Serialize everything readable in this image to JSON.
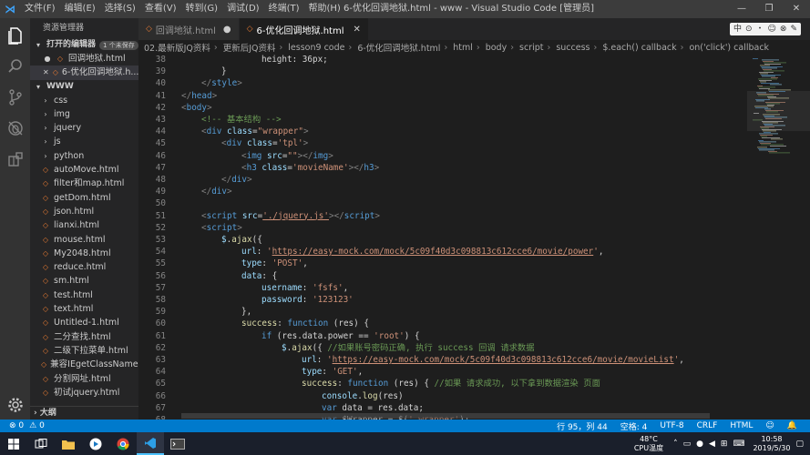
{
  "titlebar": {
    "menu": [
      "文件(F)",
      "编辑(E)",
      "选择(S)",
      "查看(V)",
      "转到(G)",
      "调试(D)",
      "终端(T)",
      "帮助(H)"
    ],
    "window_title": "6-优化回调地狱.html - www - Visual Studio Code [管理员]",
    "controls": [
      "—",
      "❐",
      "✕"
    ]
  },
  "sidebar": {
    "title": "资源管理器",
    "open_editors_label": "打开的编辑器",
    "unsaved_badge": "1 个未保存",
    "open_editors": [
      {
        "marker": "●",
        "name": "回调地狱.html"
      },
      {
        "marker": "✕",
        "name": "6-优化回调地狱.h..."
      }
    ],
    "folder": "WWW",
    "folders": [
      "css",
      "img",
      "jquery",
      "js",
      "python"
    ],
    "files": [
      "autoMove.html",
      "filter和map.html",
      "getDom.html",
      "json.html",
      "lianxi.html",
      "mouse.html",
      "My2048.html",
      "reduce.html",
      "sm.html",
      "test.html",
      "text.html",
      "Untitled-1.html",
      "二分查找.html",
      "二级下拉菜单.html",
      "兼容IEgetClassName...",
      "分割网址.html",
      "初试jquery.html"
    ],
    "outline_label": "大纲"
  },
  "tabs": [
    {
      "label": "回调地狱.html",
      "state": "●",
      "active": false
    },
    {
      "label": "6-优化回调地狱.html",
      "state": "✕",
      "active": true
    }
  ],
  "ime": [
    "中",
    "⊙",
    "・",
    "☺",
    "⊗",
    "✎"
  ],
  "breadcrumb": [
    "02.最新版JQ资料",
    "更新后JQ资料",
    "lesson9 code",
    "6-优化回调地狱.html",
    "html",
    "body",
    "script",
    "success",
    "$.each() callback",
    "on('click') callback"
  ],
  "editor": {
    "lines": [
      {
        "n": "38",
        "indent": 4,
        "tokens": [
          [
            "txt",
            "height: 36px;"
          ]
        ]
      },
      {
        "n": "39",
        "indent": 2,
        "tokens": [
          [
            "txt",
            "}"
          ]
        ]
      },
      {
        "n": "40",
        "indent": 1,
        "tokens": [
          [
            "punc",
            "</"
          ],
          [
            "tag",
            "style"
          ],
          [
            "punc",
            ">"
          ]
        ]
      },
      {
        "n": "41",
        "indent": 0,
        "tokens": [
          [
            "punc",
            "</"
          ],
          [
            "tag",
            "head"
          ],
          [
            "punc",
            ">"
          ]
        ]
      },
      {
        "n": "42",
        "indent": 0,
        "tokens": [
          [
            "punc",
            "<"
          ],
          [
            "tag",
            "body"
          ],
          [
            "punc",
            ">"
          ]
        ]
      },
      {
        "n": "43",
        "indent": 1,
        "tokens": [
          [
            "com",
            "<!-- 基本结构 -->"
          ]
        ]
      },
      {
        "n": "44",
        "indent": 1,
        "tokens": [
          [
            "punc",
            "<"
          ],
          [
            "tag",
            "div"
          ],
          [
            "txt",
            " "
          ],
          [
            "attr",
            "class"
          ],
          [
            "txt",
            "="
          ],
          [
            "str",
            "\"wrapper\""
          ],
          [
            "punc",
            ">"
          ]
        ]
      },
      {
        "n": "45",
        "indent": 2,
        "tokens": [
          [
            "punc",
            "<"
          ],
          [
            "tag",
            "div"
          ],
          [
            "txt",
            " "
          ],
          [
            "attr",
            "class"
          ],
          [
            "txt",
            "="
          ],
          [
            "str",
            "'tpl'"
          ],
          [
            "punc",
            ">"
          ]
        ]
      },
      {
        "n": "46",
        "indent": 3,
        "tokens": [
          [
            "punc",
            "<"
          ],
          [
            "tag",
            "img"
          ],
          [
            "txt",
            " "
          ],
          [
            "attr",
            "src"
          ],
          [
            "txt",
            "="
          ],
          [
            "str",
            "\"\""
          ],
          [
            "punc",
            "></"
          ],
          [
            "tag",
            "img"
          ],
          [
            "punc",
            ">"
          ]
        ]
      },
      {
        "n": "47",
        "indent": 3,
        "tokens": [
          [
            "punc",
            "<"
          ],
          [
            "tag",
            "h3"
          ],
          [
            "txt",
            " "
          ],
          [
            "attr",
            "class"
          ],
          [
            "txt",
            "="
          ],
          [
            "str",
            "'movieName'"
          ],
          [
            "punc",
            "></"
          ],
          [
            "tag",
            "h3"
          ],
          [
            "punc",
            ">"
          ]
        ]
      },
      {
        "n": "48",
        "indent": 2,
        "tokens": [
          [
            "punc",
            "</"
          ],
          [
            "tag",
            "div"
          ],
          [
            "punc",
            ">"
          ]
        ]
      },
      {
        "n": "49",
        "indent": 1,
        "tokens": [
          [
            "punc",
            "</"
          ],
          [
            "tag",
            "div"
          ],
          [
            "punc",
            ">"
          ]
        ]
      },
      {
        "n": "50",
        "indent": 0,
        "tokens": []
      },
      {
        "n": "51",
        "indent": 1,
        "tokens": [
          [
            "punc",
            "<"
          ],
          [
            "tag",
            "script"
          ],
          [
            "txt",
            " "
          ],
          [
            "attr",
            "src"
          ],
          [
            "txt",
            "="
          ],
          [
            "url",
            "'./jquery.js'"
          ],
          [
            "punc",
            "></"
          ],
          [
            "tag",
            "script"
          ],
          [
            "punc",
            ">"
          ]
        ]
      },
      {
        "n": "52",
        "indent": 1,
        "tokens": [
          [
            "punc",
            "<"
          ],
          [
            "tag",
            "script"
          ],
          [
            "punc",
            ">"
          ]
        ]
      },
      {
        "n": "53",
        "indent": 2,
        "tokens": [
          [
            "prop",
            "$"
          ],
          [
            "txt",
            "."
          ],
          [
            "fn",
            "ajax"
          ],
          [
            "txt",
            "({"
          ]
        ]
      },
      {
        "n": "54",
        "indent": 3,
        "tokens": [
          [
            "prop",
            "url"
          ],
          [
            "txt",
            ": "
          ],
          [
            "str",
            "'"
          ],
          [
            "url",
            "https://easy-mock.com/mock/5c09f40d3c098813c612cce6/movie/power"
          ],
          [
            "str",
            "'"
          ],
          [
            "txt",
            ","
          ]
        ]
      },
      {
        "n": "55",
        "indent": 3,
        "tokens": [
          [
            "prop",
            "type"
          ],
          [
            "txt",
            ": "
          ],
          [
            "str",
            "'POST'"
          ],
          [
            "txt",
            ","
          ]
        ]
      },
      {
        "n": "56",
        "indent": 3,
        "tokens": [
          [
            "prop",
            "data"
          ],
          [
            "txt",
            ": {"
          ]
        ]
      },
      {
        "n": "57",
        "indent": 4,
        "tokens": [
          [
            "prop",
            "username"
          ],
          [
            "txt",
            ": "
          ],
          [
            "str",
            "'fsfs'"
          ],
          [
            "txt",
            ","
          ]
        ]
      },
      {
        "n": "58",
        "indent": 4,
        "tokens": [
          [
            "prop",
            "password"
          ],
          [
            "txt",
            ": "
          ],
          [
            "str",
            "'123123'"
          ]
        ]
      },
      {
        "n": "59",
        "indent": 3,
        "tokens": [
          [
            "txt",
            "},"
          ]
        ]
      },
      {
        "n": "60",
        "indent": 3,
        "tokens": [
          [
            "fn",
            "success"
          ],
          [
            "txt",
            ": "
          ],
          [
            "kw",
            "function"
          ],
          [
            "txt",
            " (res) {"
          ]
        ]
      },
      {
        "n": "61",
        "indent": 4,
        "tokens": [
          [
            "kw",
            "if"
          ],
          [
            "txt",
            " (res.data.power == "
          ],
          [
            "str",
            "'root'"
          ],
          [
            "txt",
            ") {"
          ]
        ]
      },
      {
        "n": "62",
        "indent": 5,
        "tokens": [
          [
            "prop",
            "$"
          ],
          [
            "txt",
            "."
          ],
          [
            "fn",
            "ajax"
          ],
          [
            "txt",
            "({ "
          ],
          [
            "com",
            "//如果账号密码正确, 执行 success 回调 请求数据"
          ]
        ]
      },
      {
        "n": "63",
        "indent": 6,
        "tokens": [
          [
            "prop",
            "url"
          ],
          [
            "txt",
            ": "
          ],
          [
            "str",
            "'"
          ],
          [
            "url",
            "https://easy-mock.com/mock/5c09f40d3c098813c612cce6/movie/movieList"
          ],
          [
            "str",
            "'"
          ],
          [
            "txt",
            ","
          ]
        ]
      },
      {
        "n": "64",
        "indent": 6,
        "tokens": [
          [
            "prop",
            "type"
          ],
          [
            "txt",
            ": "
          ],
          [
            "str",
            "'GET'"
          ],
          [
            "txt",
            ","
          ]
        ]
      },
      {
        "n": "65",
        "indent": 6,
        "tokens": [
          [
            "fn",
            "success"
          ],
          [
            "txt",
            ": "
          ],
          [
            "kw",
            "function"
          ],
          [
            "txt",
            " (res) { "
          ],
          [
            "com",
            "//如果 请求成功, 以下拿到数据渲染 页面"
          ]
        ]
      },
      {
        "n": "66",
        "indent": 7,
        "tokens": [
          [
            "prop",
            "console"
          ],
          [
            "txt",
            "."
          ],
          [
            "fn",
            "log"
          ],
          [
            "txt",
            "(res)"
          ]
        ]
      },
      {
        "n": "67",
        "indent": 7,
        "tokens": [
          [
            "kw",
            "var"
          ],
          [
            "txt",
            " data = res.data;"
          ]
        ]
      },
      {
        "n": "68",
        "indent": 7,
        "tokens": [
          [
            "kw",
            "var"
          ],
          [
            "txt",
            " $Wrapper = $("
          ],
          [
            "str",
            "'.wrapper'"
          ],
          [
            "txt",
            ");"
          ]
        ]
      }
    ]
  },
  "statusbar": {
    "errors": "⊗ 0",
    "warnings": "⚠ 0",
    "position": "行 95，列 44",
    "spaces": "空格: 4",
    "encoding": "UTF-8",
    "eol": "CRLF",
    "language": "HTML",
    "feedback": "☺",
    "bell": "🔔"
  },
  "taskbar": {
    "temp": "48°C",
    "temp_label": "CPU温度",
    "time": "10:58",
    "date": "2019/5/30"
  },
  "colors": {
    "statusbar": "#007acc",
    "activity": "#333333",
    "sidebar": "#252526",
    "editor": "#1e1e1e"
  }
}
